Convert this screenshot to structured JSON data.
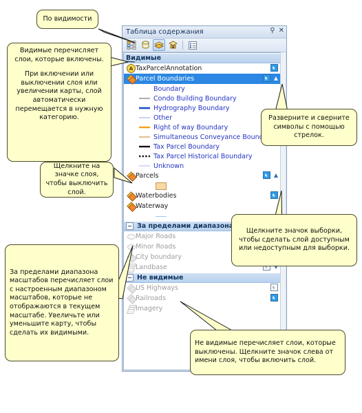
{
  "panel": {
    "title": "Таблица содержания",
    "pin_icon": "pin-icon",
    "close_icon": "close-icon",
    "toolbar": [
      {
        "name": "list-by-drawing-order-icon",
        "active": false
      },
      {
        "name": "list-by-source-icon",
        "active": false
      },
      {
        "name": "list-by-visibility-icon",
        "active": true
      },
      {
        "name": "list-by-selection-icon",
        "active": false
      },
      {
        "name": "options-icon",
        "active": false
      }
    ]
  },
  "groups": {
    "visible": {
      "label": "Видимые",
      "layers": [
        {
          "label": "TaxParcelAnnotation",
          "icon": "annotation-layer-icon",
          "selectable": true,
          "selected_row": false,
          "dim": false,
          "chevron": ""
        },
        {
          "label": "Parcel Boundaries",
          "icon": "line-layer-icon",
          "selectable": true,
          "selected_row": true,
          "dim": false,
          "chevron": "collapse"
        },
        {
          "label": "Parcels",
          "icon": "polygon-layer-icon",
          "selectable": true,
          "selected_row": false,
          "dim": false,
          "chevron": "collapse"
        },
        {
          "label": "Waterbodies",
          "icon": "polygon-layer-icon",
          "selectable": true,
          "selected_row": false,
          "dim": false,
          "chevron": ""
        },
        {
          "label": "Waterway",
          "icon": "line-layer-icon",
          "selectable": false,
          "selected_row": false,
          "dim": false,
          "chevron": ""
        }
      ],
      "parcel_boundaries_symbols": [
        {
          "label": "Boundary",
          "color": "transparent",
          "weight": 0
        },
        {
          "label": "Condo Building Boundary",
          "color": "#9a9a9a",
          "weight": 1
        },
        {
          "label": "Hydrography Boundary",
          "color": "#1a4fd0",
          "weight": 2
        },
        {
          "label": "Other",
          "color": "#b9c6f0",
          "weight": 1
        },
        {
          "label": "Right of way Boundary",
          "color": "#f3a01c",
          "weight": 2
        },
        {
          "label": "Simultaneous Conveyance Boundary",
          "color": "#e2c49a",
          "weight": 2
        },
        {
          "label": "Tax Parcel Boundary",
          "color": "#121212",
          "weight": 2
        },
        {
          "label": "Tax Parcel Historical Boundary",
          "color": "#121212",
          "weight": 2,
          "dashed": true
        },
        {
          "label": "Unknown",
          "color": "#c8d4f2",
          "weight": 1
        }
      ]
    },
    "out_of_scale": {
      "label": "За пределами диапазона масштабов",
      "layers": [
        {
          "label": "Major Roads",
          "icon": "dim-line-layer-icon",
          "selectable": false,
          "chevron": ""
        },
        {
          "label": "Minor Roads",
          "icon": "dim-line-layer-icon",
          "selectable": false,
          "chevron": ""
        },
        {
          "label": "City boundary",
          "icon": "dim-polygon-layer-icon",
          "selectable": false,
          "chevron": ""
        },
        {
          "label": "Landbase",
          "icon": "dim-group-layer-icon",
          "selectable": true,
          "chevron": "expand"
        }
      ]
    },
    "not_visible": {
      "label": "Не видимые",
      "layers": [
        {
          "label": "US Highways",
          "icon": "dim-line-layer-icon",
          "selectable": true,
          "selection_on": false
        },
        {
          "label": "Railroads",
          "icon": "dim-line-layer-icon",
          "selectable": true,
          "selection_on": true
        },
        {
          "label": "Imagery",
          "icon": "dim-raster-layer-icon",
          "selectable": false
        }
      ]
    }
  },
  "callouts": {
    "by_visibility": {
      "text": "По видимости"
    },
    "visible_explain": {
      "p1": "Видимые перечисляет слои, которые включены.",
      "p2": "При включении или выключении слоя или увеличении карты, слой автоматически перемещается в нужную категорию."
    },
    "click_layer_icon": {
      "text": "Щелкните на значке слоя, чтобы выключить слой."
    },
    "expand_collapse": {
      "text": "Разверните и сверните символы с помощью стрелок."
    },
    "selection_icon": {
      "text": "Щелкните значок выборки, чтобы сделать слой доступным или недоступным для выборки."
    },
    "out_of_scale_explain": {
      "text": "За пределами диапазона масштабов перечисляет слои с настроенным диапазоном масштабов, которые не отображаются в текущем масштабе. Увеличьте или уменьшите карту, чтобы сделать их видимыми."
    },
    "not_visible_explain": {
      "text": "Не видимые перечисляет слои, которые выключены.  Щелкните значок слева от имени слоя, чтобы включить слой."
    }
  },
  "colors": {
    "callout_bg": "#ffffcc",
    "callout_border": "#4c4c2a",
    "selection_row": "#2b87e3",
    "group_header": "#b9d2ee"
  }
}
